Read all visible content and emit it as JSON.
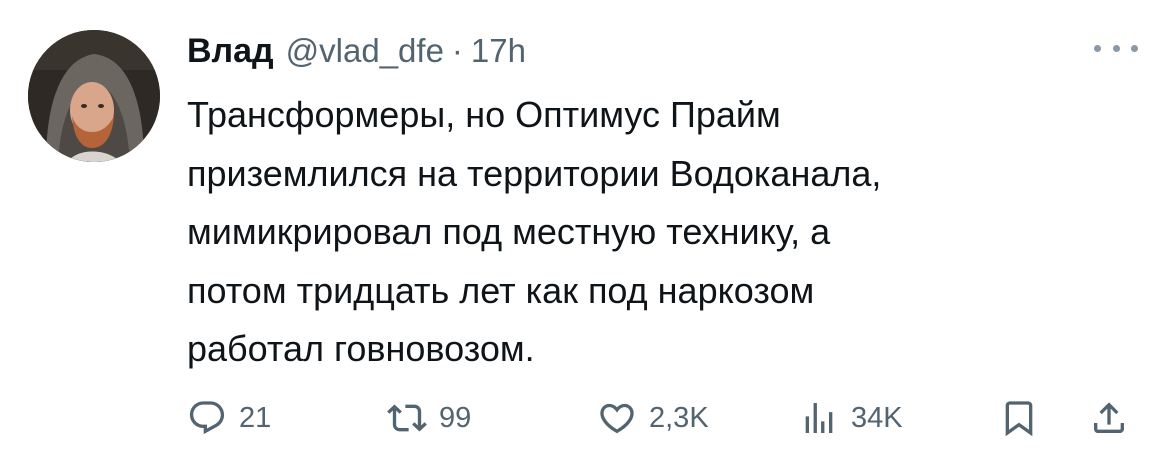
{
  "author": {
    "display_name": "Влад",
    "handle": "@vlad_dfe",
    "separator": "·",
    "time": "17h"
  },
  "tweet": {
    "lines": [
      "Трансформеры, но Оптимус Прайм",
      "приземлился на территории Водоканала,",
      "мимикрировал под местную технику, а",
      "потом тридцать лет как под наркозом",
      "работал говновозом."
    ]
  },
  "actions": {
    "replies": "21",
    "retweets": "99",
    "likes": "2,3K",
    "views": "34K"
  },
  "icons": {
    "reply": "reply-icon",
    "retweet": "retweet-icon",
    "like": "heart-icon",
    "views": "views-icon",
    "bookmark": "bookmark-icon",
    "share": "share-icon",
    "more": "more-icon"
  },
  "colors": {
    "text": "#0f1419",
    "secondary": "#536471"
  }
}
